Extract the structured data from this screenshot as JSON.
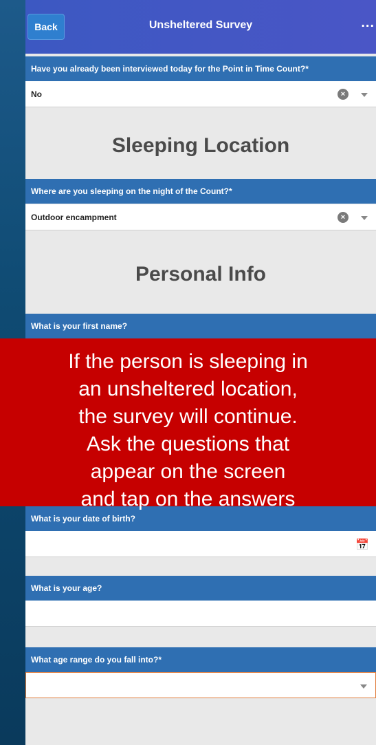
{
  "header": {
    "back_label": "Back",
    "title": "Unsheltered Survey",
    "menu_label": "..."
  },
  "questions": {
    "interviewed": {
      "label": "Have you already been interviewed today for the Point in Time Count?*",
      "value": "No"
    },
    "sleeping": {
      "label": "Where are you sleeping on the night of the Count?*",
      "value": "Outdoor encampment"
    },
    "first_name": {
      "label": "What is your first name?"
    },
    "dob": {
      "label": "What is your date of birth?"
    },
    "age": {
      "label": "What is your age?"
    },
    "age_range": {
      "label": "What age range do you fall into?*"
    }
  },
  "sections": {
    "sleeping_location": "Sleeping Location",
    "personal_info": "Personal Info"
  },
  "overlay": {
    "lines": [
      "If the person is sleeping in",
      "an unsheltered location,",
      "the survey will continue.",
      "Ask the questions that",
      "appear on the screen",
      "and tap on the answers"
    ]
  },
  "colors": {
    "header_bg": "#4a56c6",
    "question_bg": "#2f6fb2",
    "overlay_bg": "#c60000",
    "required_border": "#e07b3a"
  },
  "icons": {
    "clear": "clear-icon",
    "dropdown": "chevron-down-icon",
    "calendar": "calendar-icon"
  }
}
